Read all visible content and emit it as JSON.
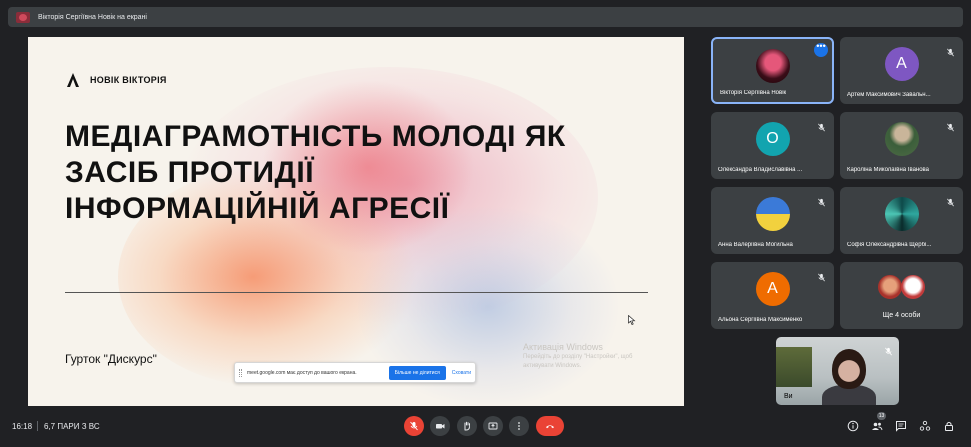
{
  "presenter_bar": {
    "text": "Вікторія Сергіївна Новік на екрані"
  },
  "slide": {
    "logo_text": "НОВІК ВІКТОРІЯ",
    "title_lines": [
      "МЕДІАГРАМОТНІСТЬ МОЛОДІ ЯК",
      "ЗАСІБ ПРОТИДІЇ",
      "ІНФОРМАЦІЙНІЙ АГРЕСІЇ"
    ],
    "club": "Гурток \"Дискурс\"",
    "activation_title": "Активація Windows",
    "activation_text_1": "Перейдіть до розділу \"Настройки\", щоб",
    "activation_text_2": "активувати Windows."
  },
  "share_notice": {
    "message": "meet.google.com має доступ до вашого екрана.",
    "stop_label": "Більше не ділитися",
    "hide_label": "Сховати"
  },
  "participants": [
    {
      "name": "Вікторія Сергіївна Новік",
      "type": "photo",
      "style": "red",
      "active": true
    },
    {
      "name": "Артем Максимович Завальн...",
      "type": "letter",
      "letter": "А",
      "color": "#7e57c2"
    },
    {
      "name": "Олександра Владиславівна ...",
      "type": "letter",
      "letter": "О",
      "color": "#12a4af"
    },
    {
      "name": "Кароліна Миколаївна Іванова",
      "type": "photo",
      "style": "lady"
    },
    {
      "name": "Анна Валеріївна Могильна",
      "type": "photo",
      "style": "flag"
    },
    {
      "name": "Софія Олександрівна Щербі...",
      "type": "photo",
      "style": "green"
    },
    {
      "name": "Альона Сергіївна Максименко",
      "type": "letter",
      "letter": "А",
      "color": "#ef6c00"
    }
  ],
  "more_tile": {
    "label": "Ще 4 особи"
  },
  "self_view": {
    "name": "Ви"
  },
  "bottom_bar": {
    "time": "16:18",
    "meeting_name": "6,7 ПАРИ З ВС",
    "participants_badge": "13"
  },
  "colors": {
    "background": "#202124",
    "tile": "#3c4043",
    "danger": "#ea4335",
    "accent": "#1a73e8"
  }
}
